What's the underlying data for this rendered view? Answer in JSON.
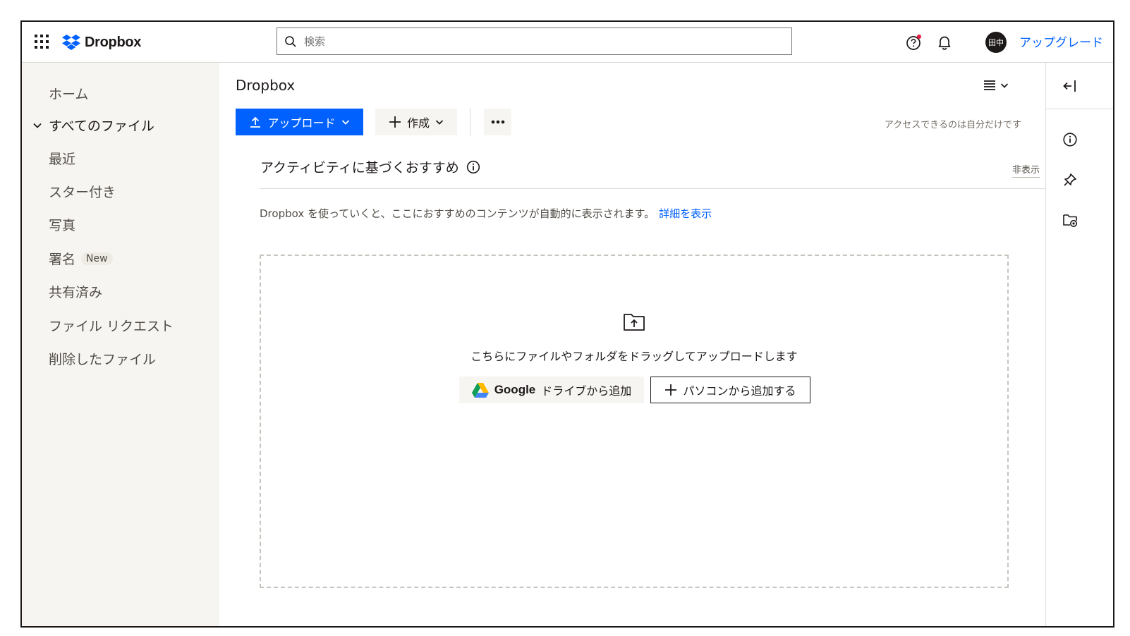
{
  "app": {
    "brand": "Dropbox",
    "search_placeholder": "検索",
    "upgrade_label": "アップグレード",
    "avatar_initials": "田中",
    "accent_color": "#0061fe",
    "notification_dot_color": "#e3193f"
  },
  "sidebar": {
    "items": [
      {
        "label": "ホーム"
      },
      {
        "label": "すべてのファイル",
        "expanded": true
      },
      {
        "label": "最近"
      },
      {
        "label": "スター付き"
      },
      {
        "label": "写真"
      },
      {
        "label": "署名",
        "badge": "New"
      },
      {
        "label": "共有済み"
      },
      {
        "label": "ファイル リクエスト"
      },
      {
        "label": "削除したファイル"
      }
    ]
  },
  "main": {
    "breadcrumb": "Dropbox",
    "upload_label": "アップロード",
    "create_label": "作成",
    "access_note": "アクセスできるのは自分だけです",
    "recommendations": {
      "title": "アクティビティに基づくおすすめ",
      "hide_label": "非表示",
      "description": "Dropbox を使っていくと、ここにおすすめのコンテンツが自動的に表示されます。",
      "details_link": "詳細を表示"
    },
    "dropzone": {
      "text": "こちらにファイルやフォルダをドラッグしてアップロードします",
      "gdrive_brand": "Google",
      "gdrive_label": "ドライブから追加",
      "pc_label": "パソコンから追加する"
    }
  },
  "rail": {
    "icons": [
      "collapse-panel-icon",
      "info-icon",
      "pin-icon",
      "folder-activity-icon"
    ]
  }
}
